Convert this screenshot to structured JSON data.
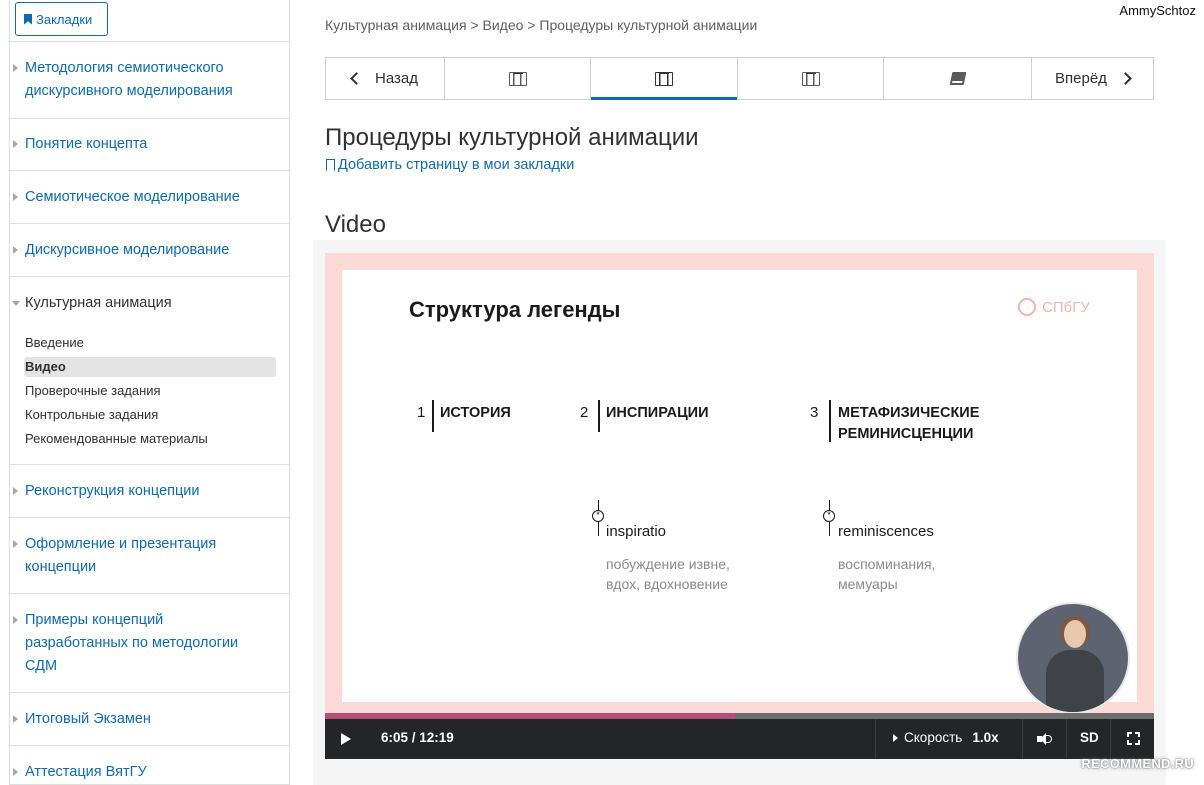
{
  "header": {
    "username": "AmmySchtoz",
    "bookmarks_label": "Закладки"
  },
  "sidebar": {
    "chapters": [
      {
        "label": "Методология семиотического дискурсивного моделирования"
      },
      {
        "label": "Понятие концепта"
      },
      {
        "label": "Семиотическое моделирование"
      },
      {
        "label": "Дискурсивное моделирование"
      },
      {
        "label": "Культурная анимация"
      },
      {
        "label": "Реконструкция концепции"
      },
      {
        "label": "Оформление и презентация концепции"
      },
      {
        "label": "Примеры концепций разработанных по методологии СДМ"
      },
      {
        "label": "Итоговый Экзамен"
      },
      {
        "label": "Аттестация ВятГУ"
      }
    ],
    "active_subsections": [
      {
        "label": "Введение"
      },
      {
        "label": "Видео"
      },
      {
        "label": "Проверочные задания"
      },
      {
        "label": "Контрольные задания"
      },
      {
        "label": "Рекомендованные материалы"
      }
    ]
  },
  "breadcrumb": "Культурная анимация > Видео > Процедуры культурной анимации",
  "sequence_nav": {
    "prev_label": "Назад",
    "next_label": "Вперёд"
  },
  "unit": {
    "title": "Процедуры культурной анимации",
    "add_bookmark": "Добавить страницу в мои закладки",
    "video_heading": "Video"
  },
  "slide": {
    "title": "Структура легенды",
    "logo": "СПбГУ",
    "items": [
      {
        "num": "1",
        "label": "ИСТОРИЯ"
      },
      {
        "num": "2",
        "label": "ИНСПИРАЦИИ",
        "term": "inspiratio",
        "gloss": "побуждение извне, вдох, вдохновение"
      },
      {
        "num": "3",
        "label": "МЕТАФИЗИЧЕСКИЕ РЕМИНИСЦЕНЦИИ",
        "term": "reminiscences",
        "gloss": "воспоминания, мемуары"
      }
    ]
  },
  "player": {
    "time": "6:05 / 12:19",
    "speed_label": "Скорость",
    "speed_value": "1.0x",
    "quality": "SD",
    "progress_fraction": 0.494,
    "progress_color": "#b2507a"
  },
  "watermark": "RECOMMEND.RU",
  "colors": {
    "link": "#0f6ab0",
    "text": "#313131"
  }
}
